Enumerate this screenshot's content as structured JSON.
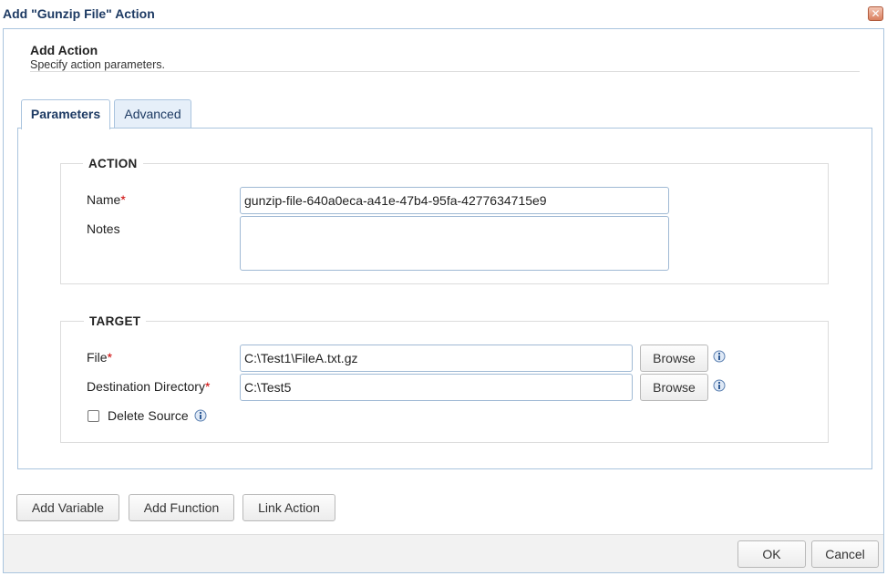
{
  "window": {
    "title": "Add \"Gunzip File\" Action",
    "close_glyph": "✕"
  },
  "header": {
    "title": "Add Action",
    "subtitle": "Specify action parameters."
  },
  "tabs": [
    {
      "label": "Parameters",
      "active": true
    },
    {
      "label": "Advanced",
      "active": false
    }
  ],
  "action_group": {
    "legend": "ACTION",
    "name_label": "Name",
    "name_value": "gunzip-file-640a0eca-a41e-47b4-95fa-4277634715e9",
    "notes_label": "Notes",
    "notes_value": ""
  },
  "target_group": {
    "legend": "TARGET",
    "file_label": "File",
    "file_value": "C:\\Test1\\FileA.txt.gz",
    "dest_label": "Destination Directory",
    "dest_value": "C:\\Test5",
    "browse_label": "Browse",
    "delete_source_label": "Delete Source",
    "delete_source_checked": false
  },
  "required_mark": "*",
  "bottom_buttons": {
    "add_variable": "Add Variable",
    "add_function": "Add Function",
    "link_action": "Link Action"
  },
  "footer": {
    "ok": "OK",
    "cancel": "Cancel"
  },
  "icons": {
    "info": "info-icon",
    "close": "close-icon"
  },
  "colors": {
    "title": "#1d3a63",
    "border": "#aac4de",
    "required": "#cc0000"
  }
}
